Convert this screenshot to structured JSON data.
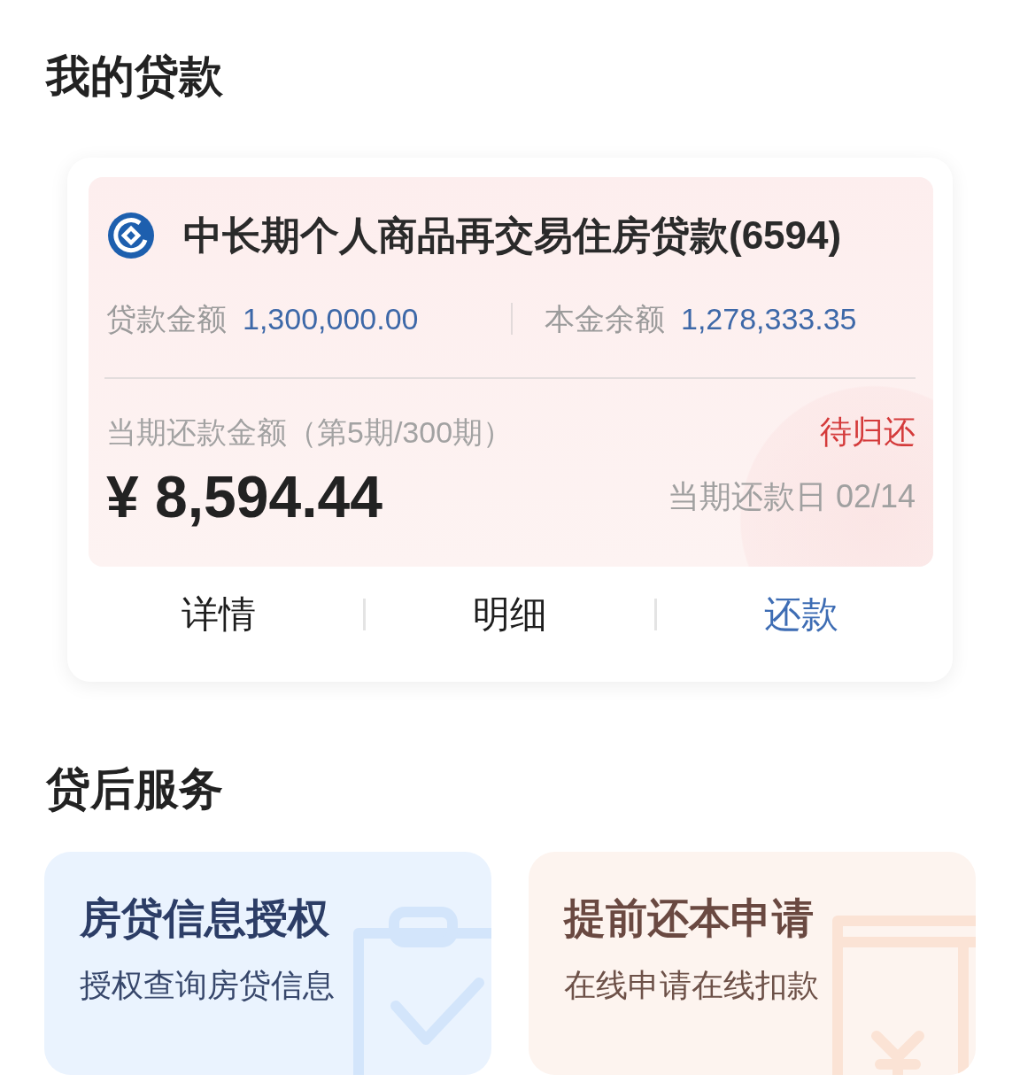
{
  "my_loans": {
    "title": "我的贷款",
    "loan": {
      "name": "中长期个人商品再交易住房贷款(6594)",
      "amounts": [
        {
          "label": "贷款金额",
          "value": "1,300,000.00"
        },
        {
          "label": "本金余额",
          "value": "1,278,333.35"
        }
      ],
      "installment_label": "当期还款金额（第5期/300期）",
      "status": "待归还",
      "amount_due": "¥ 8,594.44",
      "due_date": "当期还款日 02/14",
      "actions": [
        {
          "label": "详情",
          "kind": "plain"
        },
        {
          "label": "明细",
          "kind": "plain"
        },
        {
          "label": "还款",
          "kind": "primary"
        }
      ]
    }
  },
  "post_loan_services": {
    "title": "贷后服务",
    "items": [
      {
        "kind": "authorization",
        "title": "房贷信息授权",
        "subtitle": "授权查询房贷信息"
      },
      {
        "kind": "prepayment",
        "title": "提前还本申请",
        "subtitle": "在线申请在线扣款"
      }
    ]
  }
}
